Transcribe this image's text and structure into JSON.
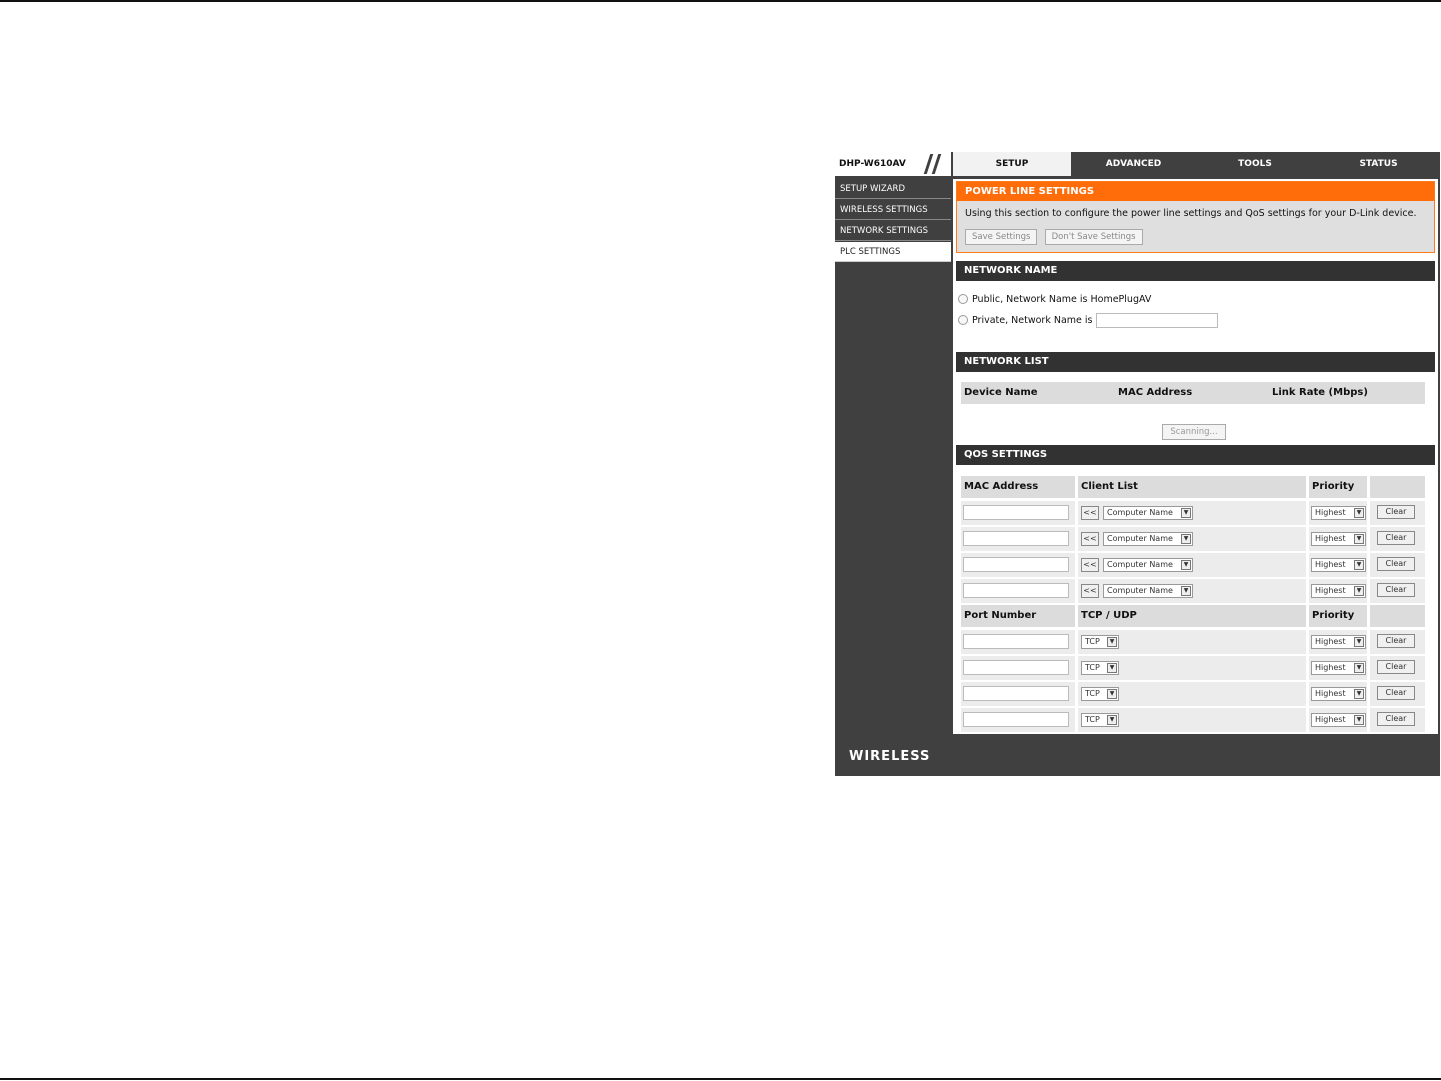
{
  "header": {
    "model": "DHP-W610AV",
    "tabs": [
      "SETUP",
      "ADVANCED",
      "TOOLS",
      "STATUS"
    ],
    "active_tab": "SETUP"
  },
  "sidebar": {
    "items": [
      "SETUP WIZARD",
      "WIRELESS SETTINGS",
      "NETWORK SETTINGS",
      "PLC SETTINGS"
    ],
    "active": "PLC SETTINGS"
  },
  "power_line": {
    "title": "POWER LINE SETTINGS",
    "description": "Using this section to configure the power line settings and QoS settings for your D-Link device.",
    "save_label": "Save Settings",
    "dont_save_label": "Don't Save Settings"
  },
  "network_name": {
    "title": "NETWORK NAME",
    "public_label": "Public, Network Name is HomePlugAV",
    "private_label": "Private, Network Name is",
    "private_value": ""
  },
  "network_list": {
    "title": "NETWORK LIST",
    "columns": [
      "Device Name",
      "MAC Address",
      "Link Rate (Mbps)"
    ],
    "scanning_label": "Scanning..."
  },
  "qos": {
    "title": "QOS SETTINGS",
    "mac_columns": [
      "MAC Address",
      "Client List",
      "Priority"
    ],
    "mac_rows": [
      {
        "mac": "",
        "copy": "<<",
        "client": "Computer Name",
        "priority": "Highest",
        "clear": "Clear"
      },
      {
        "mac": "",
        "copy": "<<",
        "client": "Computer Name",
        "priority": "Highest",
        "clear": "Clear"
      },
      {
        "mac": "",
        "copy": "<<",
        "client": "Computer Name",
        "priority": "Highest",
        "clear": "Clear"
      },
      {
        "mac": "",
        "copy": "<<",
        "client": "Computer Name",
        "priority": "Highest",
        "clear": "Clear"
      }
    ],
    "port_columns": [
      "Port Number",
      "TCP / UDP",
      "Priority"
    ],
    "port_rows": [
      {
        "port": "",
        "protocol": "TCP",
        "priority": "Highest",
        "clear": "Clear"
      },
      {
        "port": "",
        "protocol": "TCP",
        "priority": "Highest",
        "clear": "Clear"
      },
      {
        "port": "",
        "protocol": "TCP",
        "priority": "Highest",
        "clear": "Clear"
      },
      {
        "port": "",
        "protocol": "TCP",
        "priority": "Highest",
        "clear": "Clear"
      }
    ]
  },
  "footer": {
    "brand": "WIRELESS"
  },
  "colors": {
    "accent": "#ff6d0a",
    "dark_bg": "#404040",
    "section_head": "#323232"
  }
}
